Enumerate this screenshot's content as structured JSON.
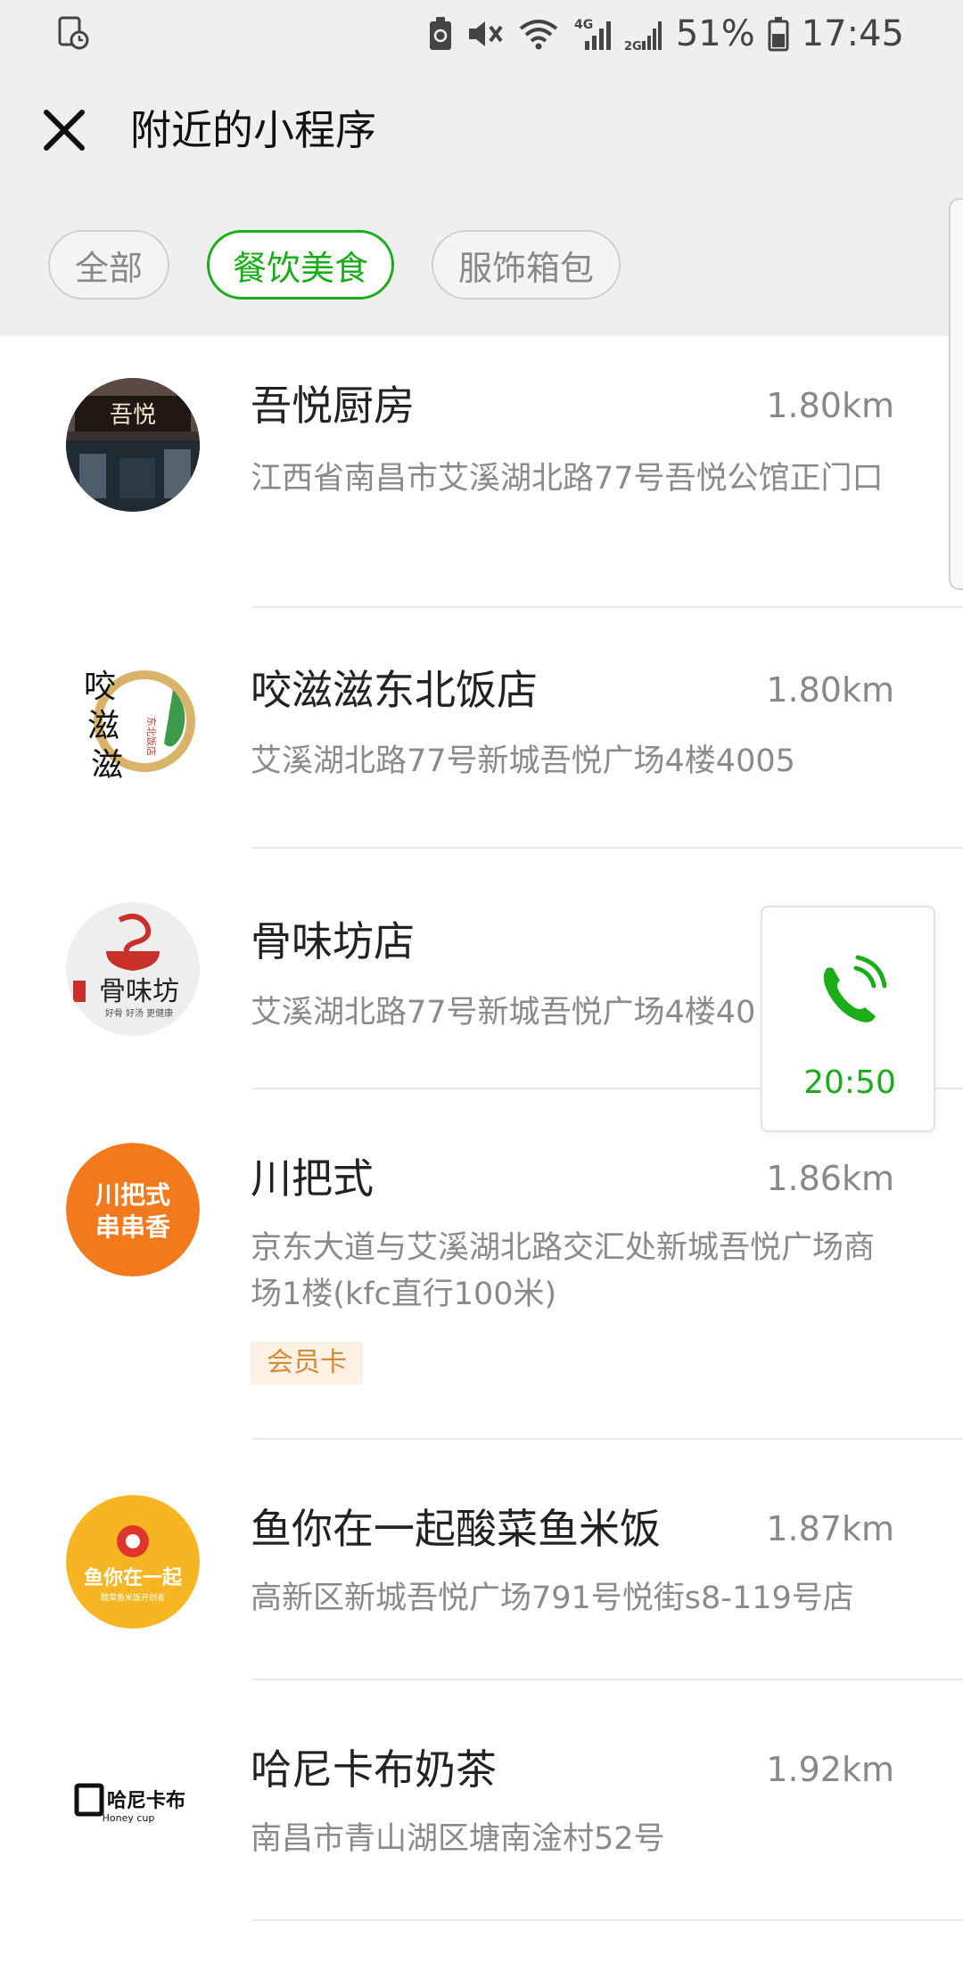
{
  "status_bar": {
    "battery": "51%",
    "time": "17:45",
    "network_4g": "4G",
    "network_2g": "2G",
    "icons": [
      "screen-timer-icon",
      "battery-saver-icon",
      "mute-icon",
      "wifi-icon",
      "signal-4g-icon",
      "signal-2g-icon",
      "battery-icon"
    ]
  },
  "header": {
    "title": "附近的小程序",
    "close_icon": "close-icon"
  },
  "filters": [
    {
      "label": "全部",
      "selected": false
    },
    {
      "label": "餐饮美食",
      "selected": true
    },
    {
      "label": "服饰箱包",
      "selected": false
    }
  ],
  "colors": {
    "accent": "#1aad19",
    "top_background": "#efefef",
    "badge_text": "#d58a3a",
    "badge_background": "#fdf1e3"
  },
  "list": [
    {
      "name": "吾悦厨房",
      "distance": "1.80km",
      "address": "江西省南昌市艾溪湖北路77号吾悦公馆正门口",
      "logo_text": "吾悦"
    },
    {
      "name": "咬滋滋东北饭店",
      "distance": "1.80km",
      "address": "艾溪湖北路77号新城吾悦广场4楼4005",
      "logo_text": "咬滋滋",
      "logo_subtext": "东北饭店"
    },
    {
      "name": "骨味坊店",
      "distance": "",
      "address": "艾溪湖北路77号新城吾悦广场4楼40",
      "logo_text": "骨味坊",
      "logo_subtext": "好骨 好汤 更健康"
    },
    {
      "name": "川把式",
      "distance": "1.86km",
      "address": "京东大道与艾溪湖北路交汇处新城吾悦广场商场1楼(kfc直行100米)",
      "badge": "会员卡",
      "logo_text": "川把式",
      "logo_subtext": "串串香"
    },
    {
      "name": "鱼你在一起酸菜鱼米饭",
      "distance": "1.87km",
      "address": "高新区新城吾悦广场791号悦街s8-119号店",
      "logo_text": "鱼你在一起",
      "logo_subtext": "酸菜鱼米饭开创者"
    },
    {
      "name": "哈尼卡布奶茶",
      "distance": "1.92km",
      "address": "南昌市青山湖区塘南淦村52号",
      "logo_text": "哈尼卡布",
      "logo_subtext": "Honey cup"
    }
  ],
  "call_widget": {
    "icon": "phone-icon",
    "time": "20:50"
  }
}
